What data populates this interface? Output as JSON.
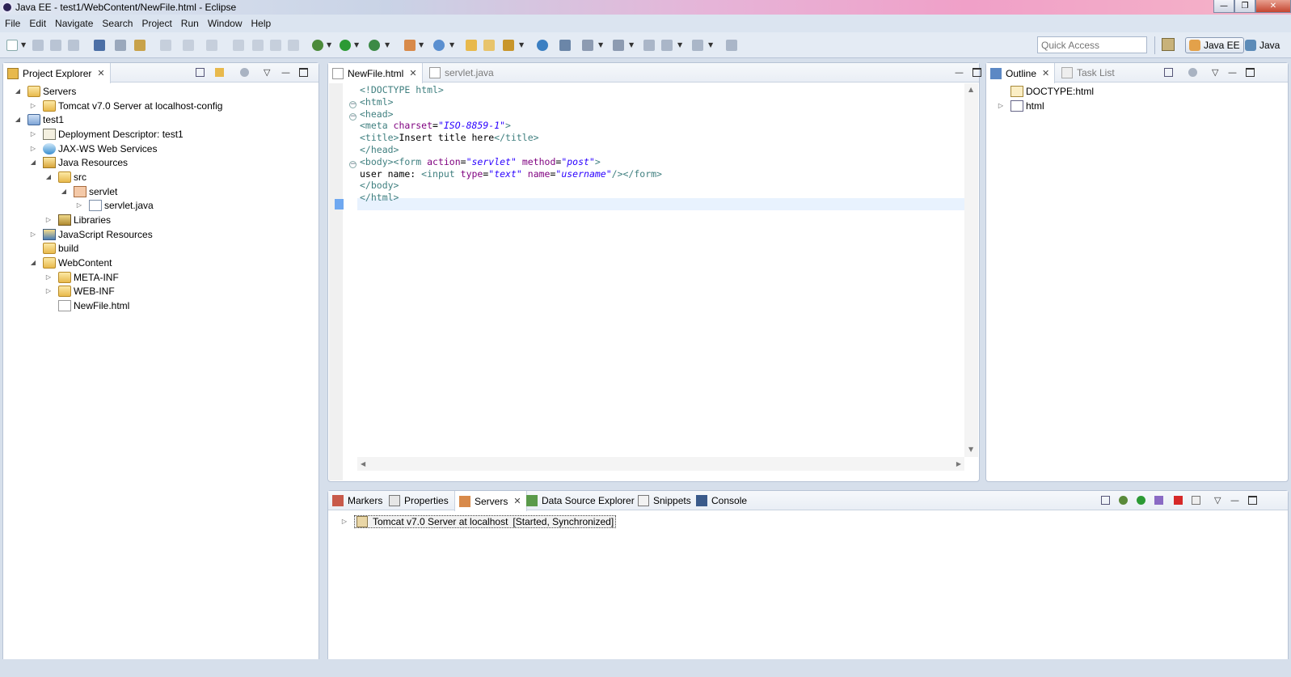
{
  "window": {
    "title": "Java EE - test1/WebContent/NewFile.html - Eclipse"
  },
  "menu": [
    "File",
    "Edit",
    "Navigate",
    "Search",
    "Project",
    "Run",
    "Window",
    "Help"
  ],
  "toolbar": {
    "quick_access_placeholder": "Quick Access"
  },
  "perspectives": [
    {
      "label": "Java EE",
      "active": true
    },
    {
      "label": "Java",
      "active": false
    }
  ],
  "project_explorer": {
    "tab": "Project Explorer",
    "tree": [
      {
        "label": "Servers",
        "icon": "folder-icon",
        "toggle": "expanded"
      },
      {
        "label": "Tomcat v7.0 Server at localhost-config",
        "icon": "folder-icon",
        "toggle": "collapsed"
      },
      {
        "label": "test1",
        "icon": "web-project-icon",
        "toggle": "expanded"
      },
      {
        "label": "Deployment Descriptor: test1",
        "icon": "deployment-descriptor-icon",
        "toggle": "collapsed"
      },
      {
        "label": "JAX-WS Web Services",
        "icon": "web-services-icon",
        "toggle": "collapsed"
      },
      {
        "label": "Java Resources",
        "icon": "java-resources-icon",
        "toggle": "expanded"
      },
      {
        "label": "src",
        "icon": "source-folder-icon",
        "toggle": "expanded"
      },
      {
        "label": "servlet",
        "icon": "package-icon",
        "toggle": "expanded"
      },
      {
        "label": "servlet.java",
        "icon": "java-file-icon",
        "toggle": "collapsed"
      },
      {
        "label": "Libraries",
        "icon": "libraries-icon",
        "toggle": "collapsed"
      },
      {
        "label": "JavaScript Resources",
        "icon": "javascript-resources-icon",
        "toggle": "collapsed"
      },
      {
        "label": "build",
        "icon": "folder-icon",
        "toggle": "none"
      },
      {
        "label": "WebContent",
        "icon": "folder-icon",
        "toggle": "expanded"
      },
      {
        "label": "META-INF",
        "icon": "folder-icon",
        "toggle": "collapsed"
      },
      {
        "label": "WEB-INF",
        "icon": "folder-icon",
        "toggle": "collapsed"
      },
      {
        "label": "NewFile.html",
        "icon": "html-file-icon",
        "toggle": "none"
      }
    ]
  },
  "editor": {
    "tabs": [
      {
        "label": "NewFile.html",
        "active": true
      },
      {
        "label": "servlet.java",
        "active": false
      }
    ],
    "code": [
      [
        {
          "t": "<!DOCTYPE html>",
          "c": "tag"
        }
      ],
      [
        {
          "t": "<html>",
          "c": "tag"
        }
      ],
      [
        {
          "t": "<head>",
          "c": "tag"
        }
      ],
      [
        {
          "t": "<meta ",
          "c": "tag"
        },
        {
          "t": "charset",
          "c": "attr"
        },
        {
          "t": "=",
          "c": ""
        },
        {
          "t": "\"ISO-8859-1\"",
          "c": "val"
        },
        {
          "t": ">",
          "c": "tag"
        }
      ],
      [
        {
          "t": "<title>",
          "c": "tag"
        },
        {
          "t": "Insert title here",
          "c": ""
        },
        {
          "t": "</title>",
          "c": "tag"
        }
      ],
      [
        {
          "t": "</head>",
          "c": "tag"
        }
      ],
      [
        {
          "t": "<body><form ",
          "c": "tag"
        },
        {
          "t": "action",
          "c": "attr"
        },
        {
          "t": "=",
          "c": ""
        },
        {
          "t": "\"servlet\"",
          "c": "val"
        },
        {
          "t": " ",
          "c": ""
        },
        {
          "t": "method",
          "c": "attr"
        },
        {
          "t": "=",
          "c": ""
        },
        {
          "t": "\"post\"",
          "c": "val"
        },
        {
          "t": ">",
          "c": "tag"
        }
      ],
      [
        {
          "t": "user name: ",
          "c": ""
        },
        {
          "t": "<input ",
          "c": "tag"
        },
        {
          "t": "type",
          "c": "attr"
        },
        {
          "t": "=",
          "c": ""
        },
        {
          "t": "\"text\"",
          "c": "val"
        },
        {
          "t": " ",
          "c": ""
        },
        {
          "t": "name",
          "c": "attr"
        },
        {
          "t": "=",
          "c": ""
        },
        {
          "t": "\"username\"",
          "c": "val"
        },
        {
          "t": "/></form>",
          "c": "tag"
        }
      ],
      [
        {
          "t": "</body>",
          "c": "tag"
        }
      ],
      [
        {
          "t": "</html>",
          "c": "tag"
        }
      ]
    ]
  },
  "outline": {
    "tabs": [
      {
        "label": "Outline",
        "active": true
      },
      {
        "label": "Task List",
        "active": false
      }
    ],
    "items": [
      {
        "label": "DOCTYPE:html",
        "toggle": "none"
      },
      {
        "label": "html",
        "toggle": "collapsed"
      }
    ]
  },
  "bottom_panel": {
    "tabs": [
      {
        "label": "Markers",
        "active": false
      },
      {
        "label": "Properties",
        "active": false
      },
      {
        "label": "Servers",
        "active": true
      },
      {
        "label": "Data Source Explorer",
        "active": false
      },
      {
        "label": "Snippets",
        "active": false
      },
      {
        "label": "Console",
        "active": false
      }
    ],
    "server": {
      "name": "Tomcat v7.0 Server at localhost",
      "state": "[Started, Synchronized]"
    }
  },
  "colors": {
    "tag": "#3f7f7f",
    "attr": "#7f007f",
    "val": "#2a00ff",
    "current_line": "#e8f2fe",
    "breakpoint_marker": "#6fa8f0"
  }
}
